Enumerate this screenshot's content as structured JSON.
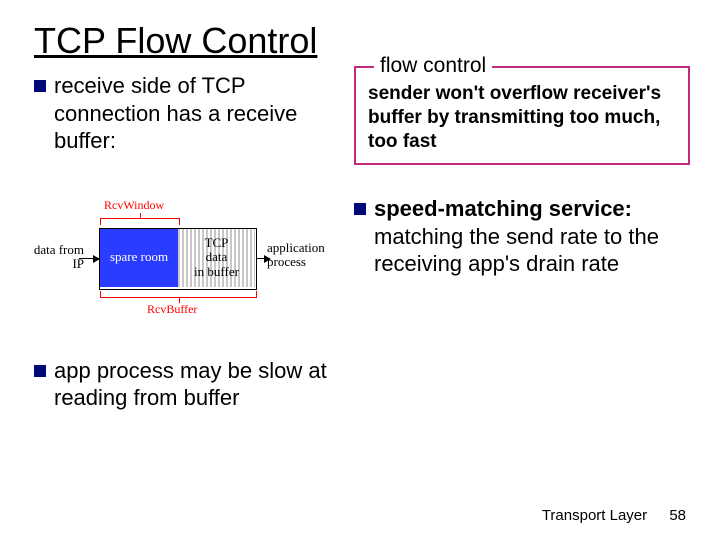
{
  "title": "TCP Flow Control",
  "left": {
    "b1": "receive side of TCP connection has a receive buffer:",
    "b2": "app process may be slow at reading from buffer"
  },
  "diagram": {
    "data_from_ip_l1": "data from",
    "data_from_ip_l2": "IP",
    "spare_room": "spare room",
    "tcp_data_l1": "TCP",
    "tcp_data_l2": "data",
    "tcp_data_l3": "in buffer",
    "app_proc_l1": "application",
    "app_proc_l2": "process",
    "rcv_window": "RcvWindow",
    "rcv_buffer": "RcvBuffer"
  },
  "fc": {
    "legend": "flow control",
    "body": "sender won't overflow receiver's buffer by transmitting too much, too fast"
  },
  "right": {
    "b1_bold": "speed-matching service:",
    "b1_rest": " matching the send rate to the receiving app's drain rate"
  },
  "footer": {
    "section": "Transport Layer",
    "page": "58"
  }
}
